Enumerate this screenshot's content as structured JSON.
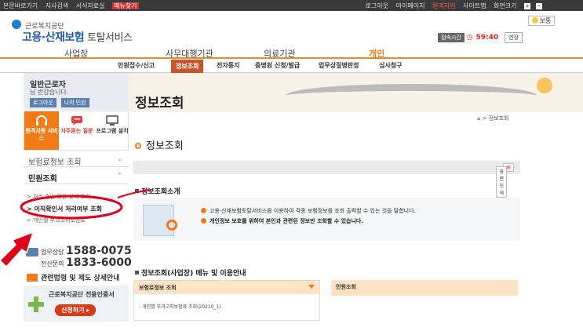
{
  "topbar": {
    "left": [
      "본문바로가기",
      "지사검색",
      "서식자료실"
    ],
    "left_highlight": "메뉴찾기",
    "right": [
      "로그아웃",
      "마이페이지"
    ],
    "right_red": "원격지원",
    "right2": [
      "사이트맵",
      "화면크기"
    ]
  },
  "brand": {
    "sub": "근로복지공단",
    "main": "고용·산재보험",
    "tail": "토탈서비스"
  },
  "session": {
    "label": "접속시간",
    "time": "59:40",
    "extend": "연장"
  },
  "vision_label": "보통",
  "gnav": [
    "사업장",
    "사무대행기관",
    "의료기관",
    "개인"
  ],
  "snav": [
    "민원접수/신고",
    "정보조회",
    "전자통지",
    "증명원 신청/발급",
    "업무상질병판정",
    "심사청구"
  ],
  "user": {
    "name": "일반근로자",
    "greeting": "님 반갑습니다.",
    "logout": "로그아웃",
    "mypage": "나의 민원"
  },
  "quick": [
    "원격지원 서비스",
    "자주묻는 질문",
    "프로그램 설치"
  ],
  "side_menu": {
    "m1": "보험료정보 조회",
    "m2": "민원조회",
    "sub1": "처리 중인 민원 상세 조회",
    "sub2": "이직확인서 처리여부 조회",
    "sub3": "개인별 부과고지보험료"
  },
  "contact": {
    "l1_label": "업무상담",
    "l1_num": "1588-0075",
    "l2_label": "전산문의",
    "l2_num": "1833-6000"
  },
  "law_link": "관련법령 및 제도 상세안내",
  "cert": {
    "title": "근로복지공단 전용인증서",
    "btn": "신청하기"
  },
  "page_title": "정보조회",
  "breadcrumb": "> 정보조회",
  "section_title": "정보조회",
  "print_btn": "화면인쇄",
  "intro": {
    "heading": "정보조회소개",
    "line1": "고용·산재보험토탈서비스를 이용하여 각종 보험정보를 조회 출력할 수 있는 것을 말합니다.",
    "line2": "개인정보 보호를 위하여 본인과 관련된 정보만 조회할 수 있습니다."
  },
  "menu_guide": {
    "heading": "정보조회(사업장) 메뉴 및 이용안내",
    "col1": "보험료정보 조회",
    "col1_item": "개인별 부과고지보험료 조회(20210_1)",
    "col2": "민원조회"
  },
  "colors": {
    "accent": "#f07b17",
    "brand": "#1d5fa8",
    "annotation": "#e0001b"
  }
}
